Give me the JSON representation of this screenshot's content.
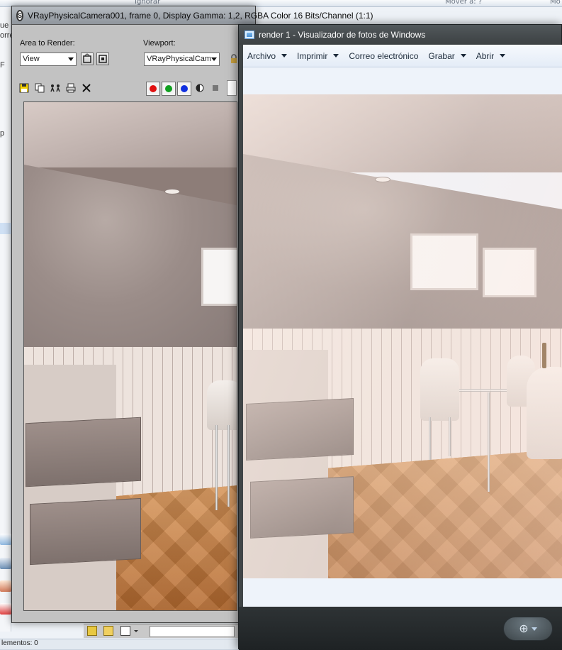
{
  "background_app": {
    "ribbon_labels": [
      "Ignorar",
      "Mover a: ?",
      "Mo"
    ],
    "left_fragments": [
      "ue",
      "orre",
      "F",
      "p"
    ],
    "status_text": "lementos: 0"
  },
  "vray_window": {
    "title": "VRayPhysicalCamera001, frame 0, Display Gamma: 1,2, RGBA Color 16 Bits/Channel (1:1)",
    "logo_glyph": "S",
    "area_to_render_label": "Area to Render:",
    "area_to_render_value": "View",
    "viewport_label": "Viewport:",
    "viewport_value": "VRayPhysicalCam",
    "channel_colors": {
      "red": "#e01010",
      "green": "#10a020",
      "blue": "#1030e0"
    }
  },
  "viewer_window": {
    "title": "render 1 - Visualizador de fotos de Windows",
    "menu": [
      {
        "label": "Archivo",
        "has_dropdown": true
      },
      {
        "label": "Imprimir",
        "has_dropdown": true
      },
      {
        "label": "Correo electrónico",
        "has_dropdown": false
      },
      {
        "label": "Grabar",
        "has_dropdown": true
      },
      {
        "label": "Abrir",
        "has_dropdown": true
      }
    ],
    "zoom_glyph": "⊕"
  }
}
